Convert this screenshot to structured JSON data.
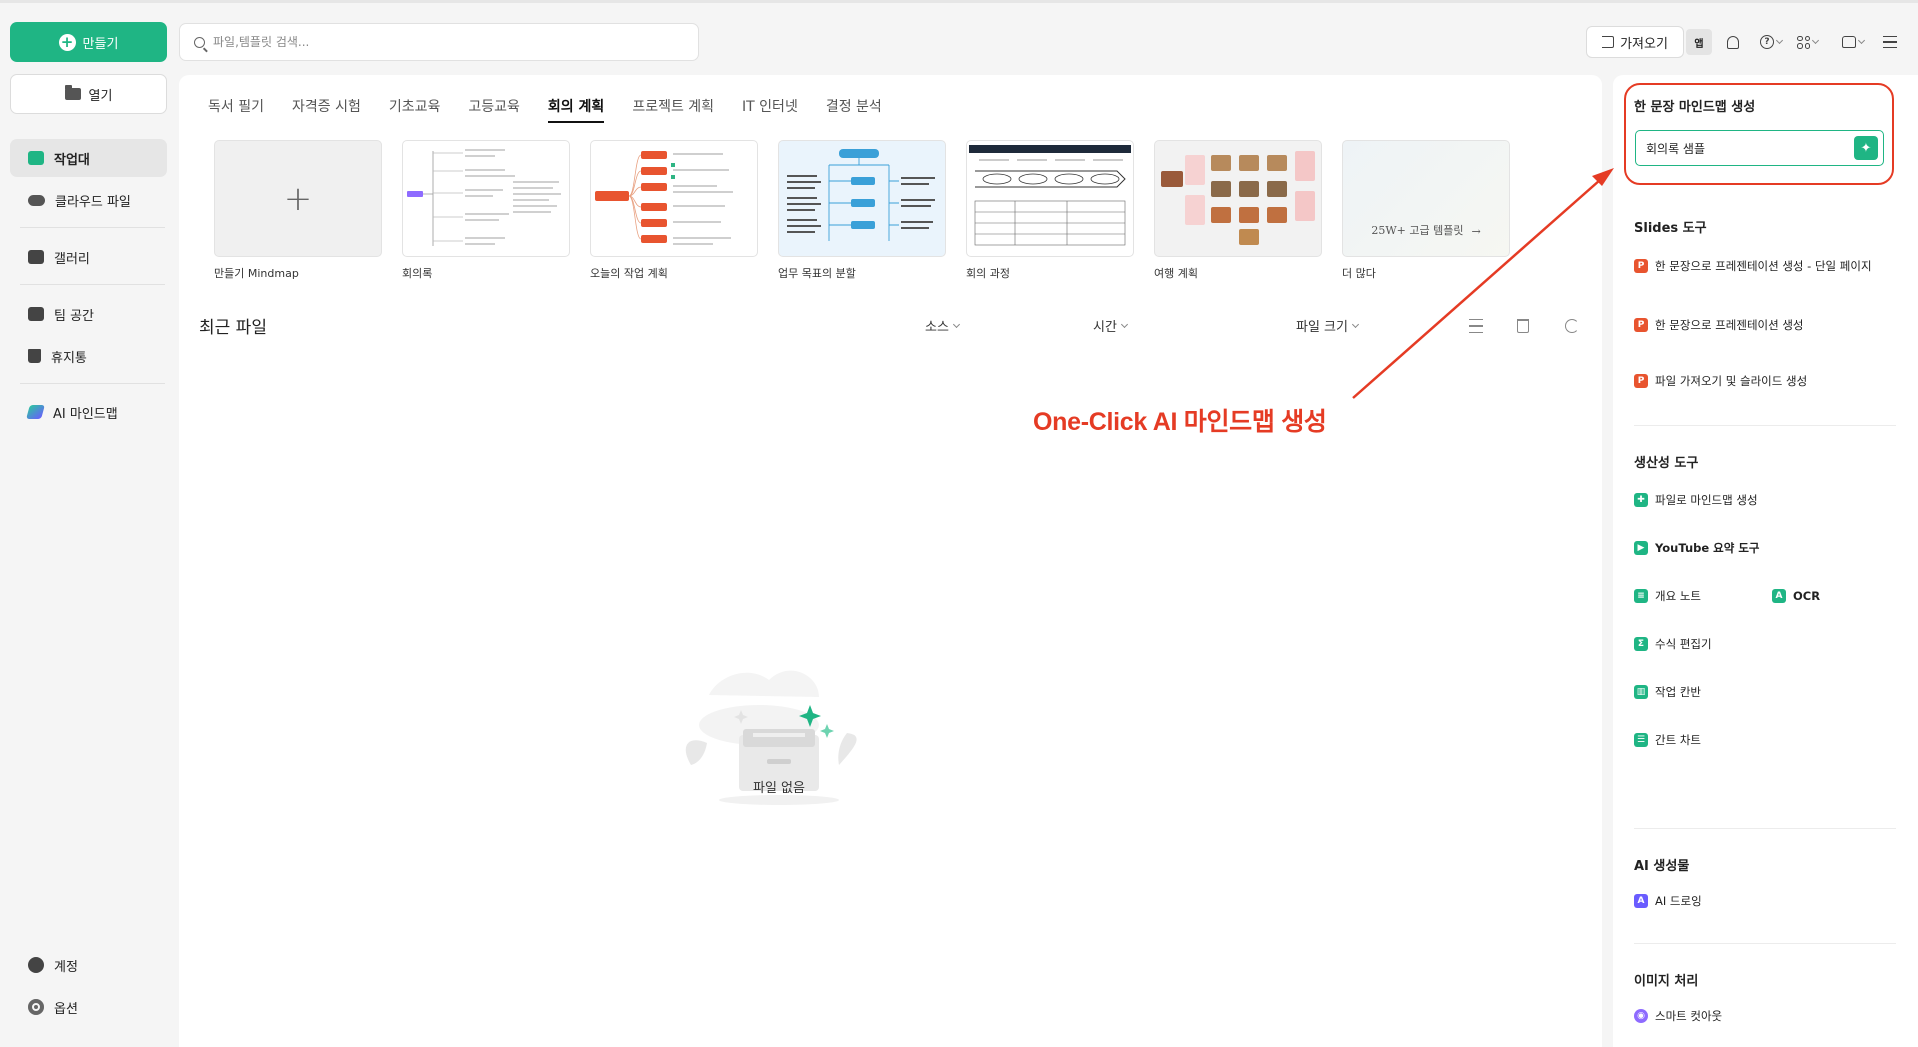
{
  "sidebar": {
    "create_label": "만들기",
    "open_label": "열기",
    "items": [
      {
        "label": "작업대",
        "icon": "workbench-icon"
      },
      {
        "label": "클라우드 파일",
        "icon": "cloud-icon"
      },
      {
        "label": "갤러리",
        "icon": "gallery-icon"
      },
      {
        "label": "팀 공간",
        "icon": "team-space-icon"
      },
      {
        "label": "휴지통",
        "icon": "trash-icon"
      },
      {
        "label": "AI 마인드맵",
        "icon": "ai-mindmap-icon"
      }
    ],
    "bottom": [
      {
        "label": "계정",
        "icon": "account-icon"
      },
      {
        "label": "옵션",
        "icon": "gear-icon"
      }
    ]
  },
  "search": {
    "placeholder": "파일,템플릿 검색..."
  },
  "toolbar": {
    "import_label": "가져오기",
    "app_label": "앱"
  },
  "tabs": [
    {
      "label": "독서 필기"
    },
    {
      "label": "자격증 시험"
    },
    {
      "label": "기초교육"
    },
    {
      "label": "고등교육"
    },
    {
      "label": "회의 계획",
      "active": true
    },
    {
      "label": "프로젝트 계획"
    },
    {
      "label": "IT 인터넷"
    },
    {
      "label": "결정 분석"
    }
  ],
  "templates": [
    {
      "label": "만들기 Mindmap"
    },
    {
      "label": "회의록"
    },
    {
      "label": "오늘의 작업 계획"
    },
    {
      "label": "업무 목표의 분할"
    },
    {
      "label": "회의 과정"
    },
    {
      "label": "여행 계획"
    },
    {
      "label": "더 많다",
      "card_text": "25W+ 고급 템플릿"
    }
  ],
  "recent": {
    "title": "최근 파일",
    "columns": [
      "소스",
      "시간",
      "파일 크기"
    ],
    "empty_label": "파일 없음"
  },
  "right_panel": {
    "oneline_title": "한 문장 마인드맵 생성",
    "oneline_value": "회의록 샘플",
    "slides_title": "Slides 도구",
    "slides_items": [
      "한 문장으로 프레젠테이션 생성 - 단일 페이지",
      "한 문장으로 프레젠테이션 생성",
      "파일 가져오기 및 슬라이드 생성"
    ],
    "productivity_title": "생산성 도구",
    "productivity_items": [
      "파일로 마인드맵 생성",
      "YouTube 요약 도구",
      "개요 노트",
      "OCR",
      "수식 편집기",
      "작업 칸반",
      "간트 차트"
    ],
    "ai_title": "AI 생성물",
    "ai_items": [
      "AI 드로잉"
    ],
    "image_title": "이미지 처리",
    "image_items": [
      "스마트 컷아웃"
    ]
  },
  "annotation": {
    "text": "One-Click AI 마인드맵 생성",
    "color": "#e53b24"
  },
  "colors": {
    "accent": "#1fb584",
    "annotation": "#e53b24"
  }
}
